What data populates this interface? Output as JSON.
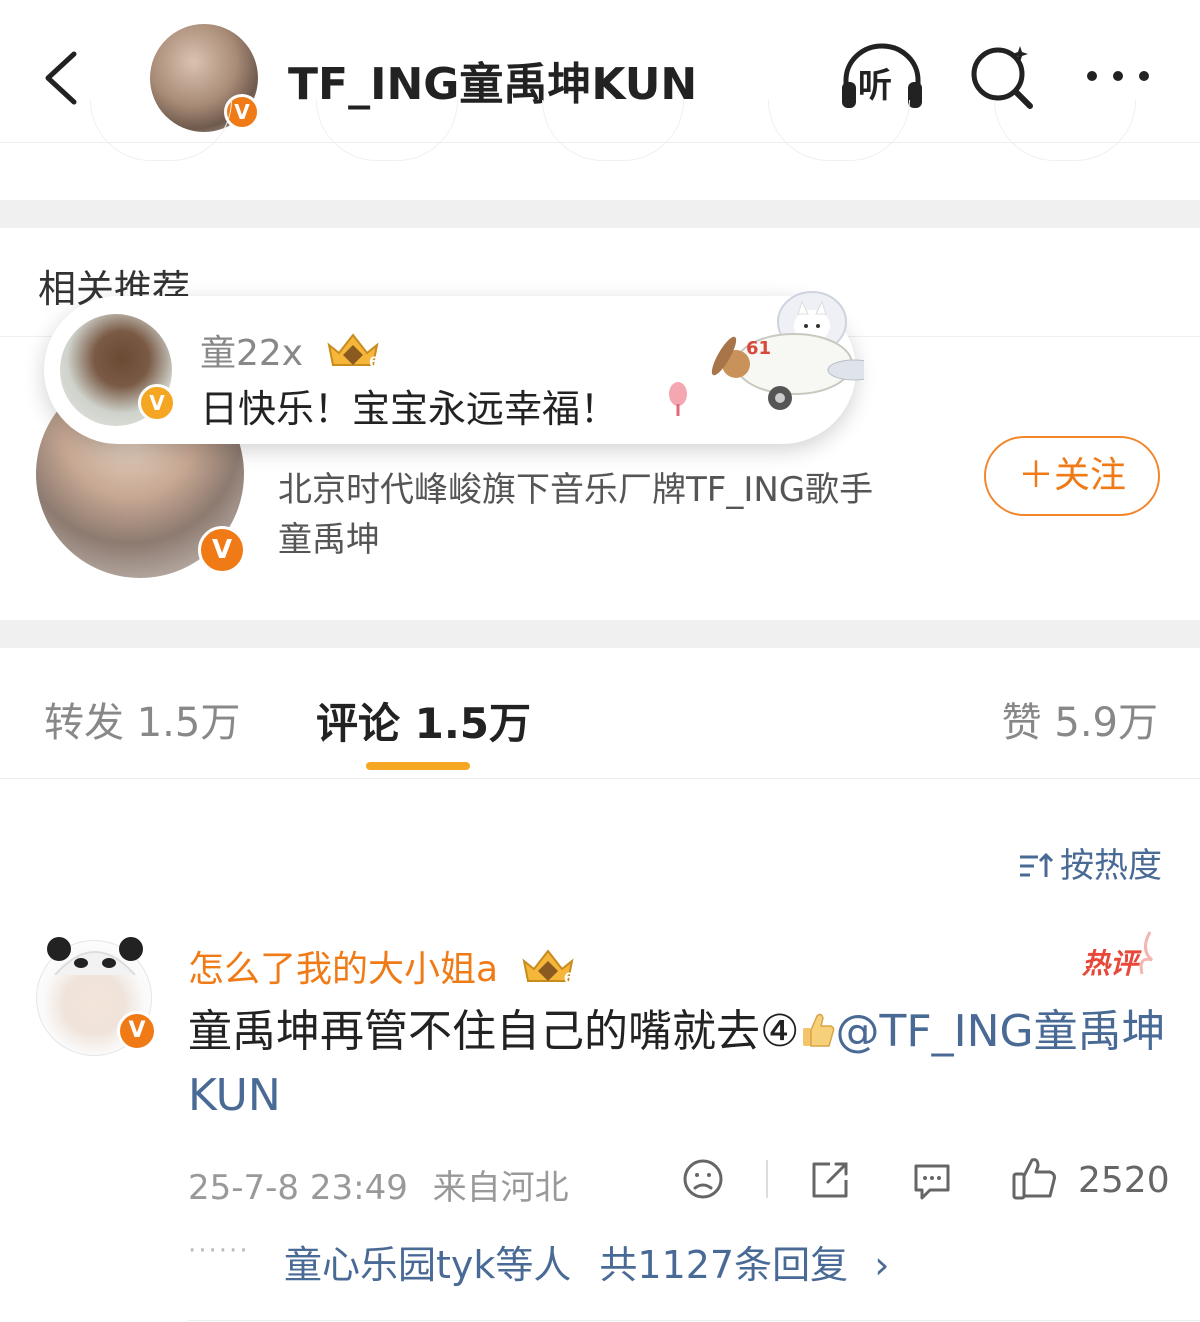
{
  "header": {
    "title": "TF_ING童禹坤KUN",
    "listen_label": "听",
    "verified_mark": "V"
  },
  "related": {
    "title": "相关推荐",
    "description_line1": "北京时代峰峻旗下音乐厂牌TF_ING歌手",
    "description_line2": "童禹坤",
    "follow_label": "＋关注",
    "verified_mark": "V"
  },
  "bubble": {
    "username": "童22x",
    "text": "日快乐！宝宝永远幸福！",
    "crown_level": "6",
    "plane_number": "61",
    "verified_mark": "V"
  },
  "tabs": {
    "repost": "转发 1.5万",
    "comment": "评论 1.5万",
    "like": "赞 5.9万"
  },
  "sort_label": "按热度",
  "comment": {
    "username": "怎么了我的大小姐a",
    "crown_level": "6",
    "hot_tag": "热评",
    "text": "童禹坤再管不住自己的嘴就去④",
    "mention": "@TF_ING童禹坤KUN",
    "timestamp": "25-7-8 23:49",
    "location": "来自河北",
    "like_count": "2520",
    "reply_dots": "······",
    "reply_users": "童心乐园tyk等人",
    "reply_total": "共1127条回复",
    "reply_chevron": "›",
    "verified_mark": "V"
  },
  "colors": {
    "accent_orange": "#f07a16",
    "link_blue": "#4a6a96",
    "tab_indicator": "#f5a623",
    "hot_red": "#e8483a"
  }
}
